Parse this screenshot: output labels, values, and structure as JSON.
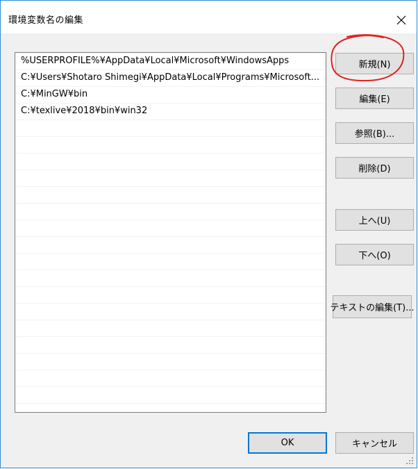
{
  "window": {
    "title": "環境変数名の編集",
    "close_icon": "close-icon",
    "border_color": "#2b8cd6"
  },
  "paths": [
    "%USERPROFILE%¥AppData¥Local¥Microsoft¥WindowsApps",
    "C:¥Users¥Shotaro Shimegi¥AppData¥Local¥Programs¥Microsoft...",
    "C:¥MinGW¥bin",
    "C:¥texlive¥2018¥bin¥win32"
  ],
  "buttons": {
    "new": "新規(N)",
    "edit": "編集(E)",
    "browse": "参照(B)...",
    "delete": "削除(D)",
    "move_up": "上へ(U)",
    "move_down": "下へ(O)",
    "edit_text": "テキストの編集(T)...",
    "ok": "OK",
    "cancel": "キャンセル"
  },
  "colors": {
    "annotation": "#e02020",
    "default_button_border": "#0078d7"
  }
}
